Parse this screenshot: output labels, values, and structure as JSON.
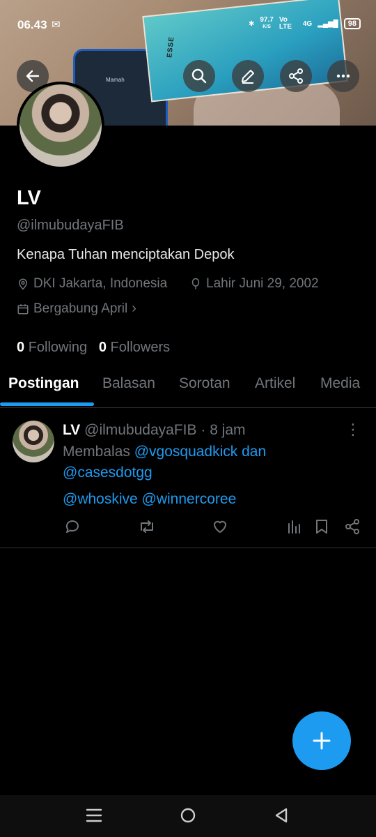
{
  "status_bar": {
    "time": "06.43",
    "speed": "97.7",
    "speed_unit": "K/S",
    "network": "Vo LTE",
    "signal": "4G",
    "battery": "98"
  },
  "banner": {
    "phone_text": "Mamah",
    "box_label": "ESSE"
  },
  "profile": {
    "name": "LV",
    "handle": "@ilmubudayaFIB",
    "bio": "Kenapa Tuhan menciptakan Depok",
    "location": "DKI Jakarta, Indonesia",
    "birthday": "Lahir Juni 29, 2002",
    "joined": "Bergabung April",
    "following_count": "0",
    "following_label": "Following",
    "followers_count": "0",
    "followers_label": "Followers"
  },
  "tabs": [
    {
      "label": "Postingan",
      "active": true
    },
    {
      "label": "Balasan",
      "active": false
    },
    {
      "label": "Sorotan",
      "active": false
    },
    {
      "label": "Artikel",
      "active": false
    },
    {
      "label": "Media",
      "active": false
    }
  ],
  "post": {
    "name": "LV",
    "handle": "@ilmubudayaFIB",
    "time": "8 jam",
    "reply_prefix": "Membalas",
    "mention_1": "@vgosquadkick",
    "conjunction": "dan",
    "mention_2": "@casesdotgg",
    "body_mention_1": "@whoskive",
    "body_mention_2": "@winnercoree"
  },
  "colors": {
    "accent": "#1d9bf0",
    "background": "#000000",
    "muted": "#71767b"
  }
}
